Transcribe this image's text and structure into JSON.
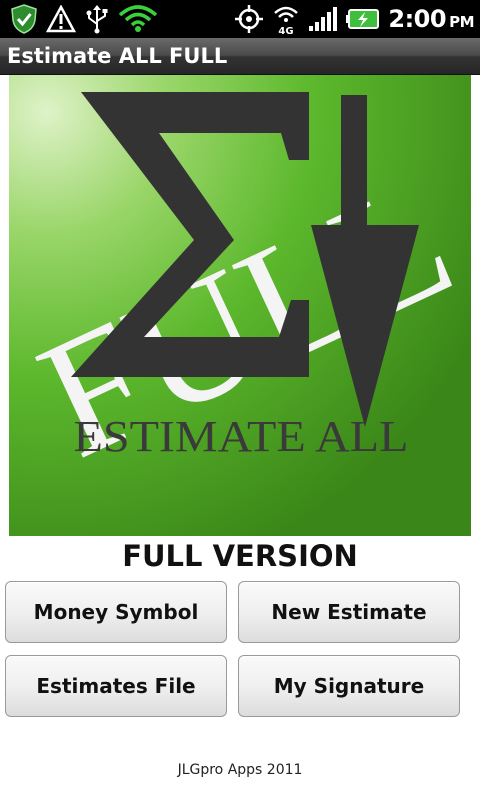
{
  "status_bar": {
    "time": "2:00",
    "ampm": "PM",
    "network_label": "4G",
    "icons": [
      "shield-check-icon",
      "warning-icon",
      "usb-icon",
      "wifi-icon",
      "gps-icon",
      "4g-signal-icon",
      "cell-signal-icon",
      "battery-charging-icon"
    ]
  },
  "title_bar": {
    "title": "Estimate ALL FULL"
  },
  "logo": {
    "watermark_text": "FULL",
    "caption_text": "ESTIMATE ALL",
    "colors": {
      "green_light": "#c8e8a8",
      "green_mid": "#5cb82c",
      "green_dark": "#3e8a1a",
      "glyph": "#333333"
    }
  },
  "main": {
    "version_label": "FULL VERSION",
    "buttons": {
      "money_symbol": "Money Symbol",
      "new_estimate": "New Estimate",
      "estimates_file": "Estimates File",
      "my_signature": "My Signature"
    }
  },
  "footer": {
    "text": "JLGpro Apps 2011"
  }
}
